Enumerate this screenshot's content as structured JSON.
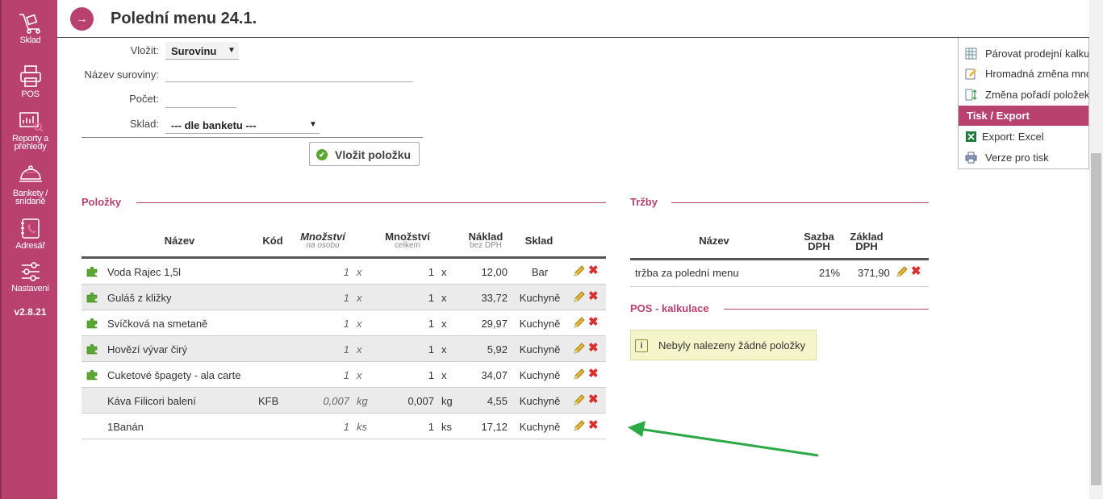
{
  "sidebar": {
    "items": [
      {
        "label": "Sklad",
        "icon": "warehouse-icon"
      },
      {
        "label": "POS",
        "icon": "printer-icon"
      },
      {
        "label1": "Reporty a",
        "label2": "přehledy",
        "icon": "report-icon"
      },
      {
        "label1": "Bankety /",
        "label2": "snídaně",
        "icon": "banquet-icon"
      },
      {
        "label": "Adresář",
        "icon": "addressbook-icon"
      },
      {
        "label": "Nastavení",
        "icon": "settings-icon"
      }
    ],
    "version": "v2.8.21"
  },
  "header": {
    "back_icon": "→",
    "title": "Polední menu 24.1."
  },
  "form": {
    "vlozit_label": "Vložit:",
    "vlozit_value": "Surovinu",
    "nazev_label": "Název suroviny:",
    "pocet_label": "Počet:",
    "sklad_label": "Sklad:",
    "sklad_value": "--- dle banketu ---",
    "submit_label": "Vložit položku"
  },
  "polozky": {
    "title": "Položky",
    "headers": {
      "nazev": "Název",
      "kod": "Kód",
      "mnozstvi_osoba": "Množství",
      "mnozstvi_osoba_sub": "na osobu",
      "mnozstvi_celkem": "Množství",
      "mnozstvi_celkem_sub": "celkem",
      "naklad": "Náklad",
      "naklad_sub": "bez DPH",
      "sklad": "Sklad"
    },
    "rows": [
      {
        "nazev": "Voda Rajec 1,5l",
        "kod": "",
        "per_osoba": "1",
        "unit1": "x",
        "celkem": "1",
        "unit2": "x",
        "naklad": "12,00",
        "sklad": "Bar",
        "puzzle": true
      },
      {
        "nazev": "Guláš z kližky",
        "kod": "",
        "per_osoba": "1",
        "unit1": "x",
        "celkem": "1",
        "unit2": "x",
        "naklad": "33,72",
        "sklad": "Kuchyně",
        "puzzle": true
      },
      {
        "nazev": "Svíčková na smetaně",
        "kod": "",
        "per_osoba": "1",
        "unit1": "x",
        "celkem": "1",
        "unit2": "x",
        "naklad": "29,97",
        "sklad": "Kuchyně",
        "puzzle": true
      },
      {
        "nazev": "Hovězí vývar čirý",
        "kod": "",
        "per_osoba": "1",
        "unit1": "x",
        "celkem": "1",
        "unit2": "x",
        "naklad": "5,92",
        "sklad": "Kuchyně",
        "puzzle": true
      },
      {
        "nazev": "Cuketové špagety - ala carte",
        "kod": "",
        "per_osoba": "1",
        "unit1": "x",
        "celkem": "1",
        "unit2": "x",
        "naklad": "34,07",
        "sklad": "Kuchyně",
        "puzzle": true
      },
      {
        "nazev": "Káva Filicori balení",
        "kod": "KFB",
        "per_osoba": "0,007",
        "unit1": "kg",
        "celkem": "0,007",
        "unit2": "kg",
        "naklad": "4,55",
        "sklad": "Kuchyně",
        "puzzle": false
      },
      {
        "nazev": "1Banán",
        "kod": "",
        "per_osoba": "1",
        "unit1": "ks",
        "celkem": "1",
        "unit2": "ks",
        "naklad": "17,12",
        "sklad": "Kuchyně",
        "puzzle": false
      }
    ]
  },
  "trzby": {
    "title": "Tržby",
    "headers": {
      "nazev": "Název",
      "sazba1": "Sazba",
      "sazba2": "DPH",
      "zaklad1": "Základ",
      "zaklad2": "DPH"
    },
    "row": {
      "nazev": "tržba za polední menu",
      "sazba": "21%",
      "zaklad": "371,90"
    }
  },
  "pos": {
    "title": "POS - kalkulace",
    "notice": "Nebyly nalezeny žádné položky",
    "notice_icon": "i"
  },
  "dropdown": {
    "items": [
      {
        "label": "Párovat prodejní kalkulace",
        "icon": "grid-icon"
      },
      {
        "label": "Hromadná změna množství",
        "icon": "edit-note-icon"
      },
      {
        "label": "Změna pořadí položek",
        "icon": "reorder-icon"
      }
    ],
    "section": "Tisk / Export",
    "export_items": [
      {
        "label": "Export: Excel",
        "icon": "excel-icon"
      },
      {
        "label": "Verze pro tisk",
        "icon": "print-icon"
      }
    ]
  },
  "colors": {
    "accent": "#b9416d",
    "delete": "#d83030",
    "puzzle": "#5aa832",
    "arrow": "#2aaa44"
  }
}
